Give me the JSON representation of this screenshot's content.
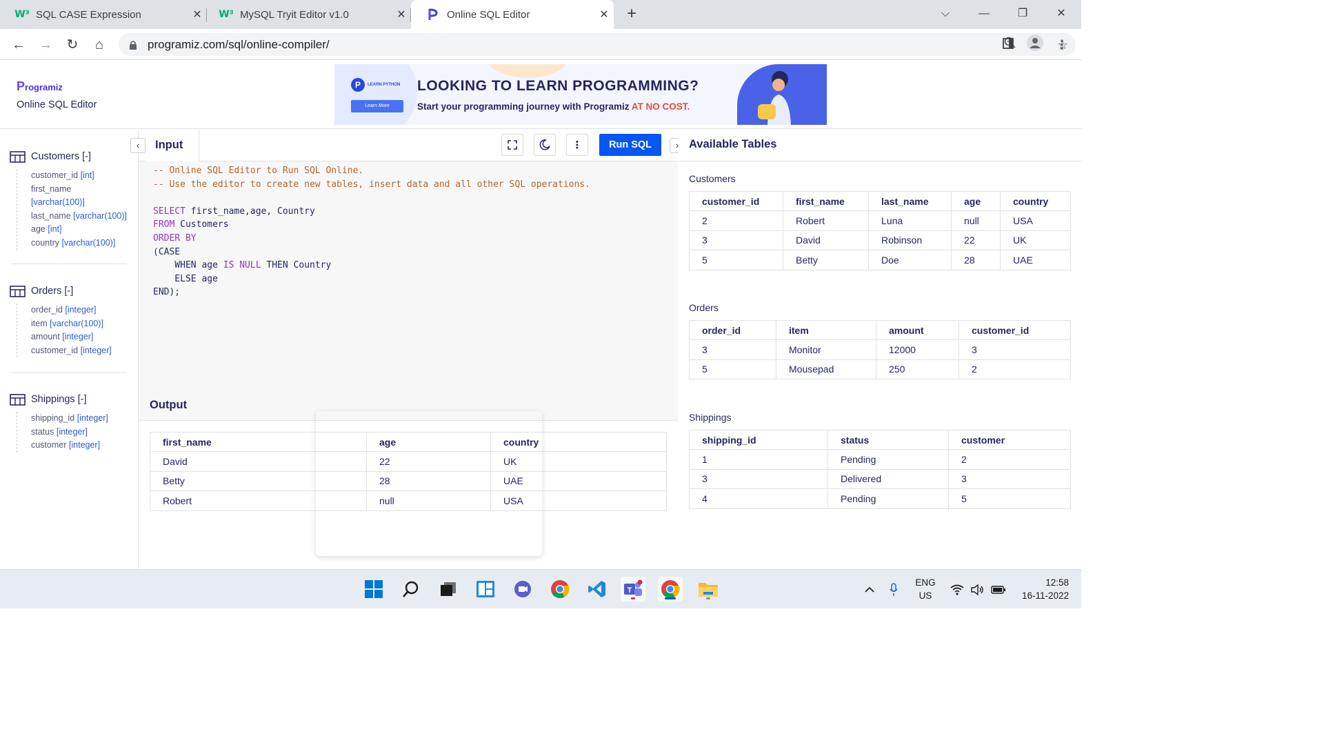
{
  "browser": {
    "tabs": [
      {
        "title": "SQL CASE Expression",
        "icon": "w3schools-icon"
      },
      {
        "title": "MySQL Tryit Editor v1.0",
        "icon": "w3schools-icon"
      },
      {
        "title": "Online SQL Editor",
        "icon": "programiz-icon"
      }
    ],
    "url": "programiz.com/sql/online-compiler/"
  },
  "header": {
    "logo": "rogramiz",
    "logo_p": "P",
    "subtitle": "Online SQL Editor"
  },
  "banner": {
    "learn_python": "LEARN PYTHON",
    "learn_more": "Learn More",
    "headline": "LOOKING TO LEARN PROGRAMMING?",
    "sub_text": "Start your programming journey with Programiz ",
    "sub_highlight": "AT NO COST."
  },
  "schema": {
    "tables": [
      {
        "name": "Customers [-]",
        "columns": [
          {
            "name": "customer_id",
            "type": "[int]"
          },
          {
            "name": "first_name",
            "type": "[varchar(100)]"
          },
          {
            "name": "last_name",
            "type": "[varchar(100)]"
          },
          {
            "name": "age",
            "type": "[int]"
          },
          {
            "name": "country",
            "type": "[varchar(100)]"
          }
        ]
      },
      {
        "name": "Orders [-]",
        "columns": [
          {
            "name": "order_id",
            "type": "[integer]"
          },
          {
            "name": "item",
            "type": "[varchar(100)]"
          },
          {
            "name": "amount",
            "type": "[integer]"
          },
          {
            "name": "customer_id",
            "type": "[integer]"
          }
        ]
      },
      {
        "name": "Shippings [-]",
        "columns": [
          {
            "name": "shipping_id",
            "type": "[integer]"
          },
          {
            "name": "status",
            "type": "[integer]"
          },
          {
            "name": "customer",
            "type": "[integer]"
          }
        ]
      }
    ]
  },
  "editor": {
    "tab_label": "Input",
    "run_label": "Run SQL",
    "code_lines": [
      [
        {
          "c": "cm",
          "t": "-- Online SQL Editor to Run SQL Online."
        }
      ],
      [
        {
          "c": "cm",
          "t": "-- Use the editor to create new tables, insert data and all other SQL operations."
        }
      ],
      [
        {
          "c": "pl",
          "t": " "
        }
      ],
      [
        {
          "c": "kw",
          "t": "SELECT"
        },
        {
          "c": "pl",
          "t": " first_name,age, Country"
        }
      ],
      [
        {
          "c": "kw",
          "t": "FROM"
        },
        {
          "c": "pl",
          "t": " Customers"
        }
      ],
      [
        {
          "c": "kw",
          "t": "ORDER BY"
        }
      ],
      [
        {
          "c": "pl",
          "t": "(CASE"
        }
      ],
      [
        {
          "c": "pl",
          "t": "    WHEN age "
        },
        {
          "c": "kw",
          "t": "IS NULL"
        },
        {
          "c": "pl",
          "t": " THEN Country"
        }
      ],
      [
        {
          "c": "pl",
          "t": "    ELSE age"
        }
      ],
      [
        {
          "c": "pl",
          "t": "END);"
        }
      ]
    ]
  },
  "output": {
    "title": "Output",
    "headers": [
      "first_name",
      "age",
      "country"
    ],
    "rows": [
      [
        "David",
        "22",
        "UK"
      ],
      [
        "Betty",
        "28",
        "UAE"
      ],
      [
        "Robert",
        "null",
        "USA"
      ]
    ]
  },
  "available": {
    "title": "Available Tables",
    "tables": [
      {
        "name": "Customers",
        "headers": [
          "customer_id",
          "first_name",
          "last_name",
          "age",
          "country"
        ],
        "rows": [
          [
            "2",
            "Robert",
            "Luna",
            "null",
            "USA"
          ],
          [
            "3",
            "David",
            "Robinson",
            "22",
            "UK"
          ],
          [
            "5",
            "Betty",
            "Doe",
            "28",
            "UAE"
          ]
        ]
      },
      {
        "name": "Orders",
        "headers": [
          "order_id",
          "item",
          "amount",
          "customer_id"
        ],
        "rows": [
          [
            "3",
            "Monitor",
            "12000",
            "3"
          ],
          [
            "5",
            "Mousepad",
            "250",
            "2"
          ]
        ]
      },
      {
        "name": "Shippings",
        "headers": [
          "shipping_id",
          "status",
          "customer"
        ],
        "rows": [
          [
            "1",
            "Pending",
            "2"
          ],
          [
            "3",
            "Delivered",
            "3"
          ],
          [
            "4",
            "Pending",
            "5"
          ]
        ]
      }
    ]
  },
  "taskbar": {
    "lang_top": "ENG",
    "lang_bottom": "US",
    "time": "12:58",
    "date": "16-11-2022"
  },
  "colors": {
    "accent": "#0556f3",
    "keyword": "#8a3ab9",
    "comment": "#b5632a",
    "type": "#2a5bd7"
  }
}
